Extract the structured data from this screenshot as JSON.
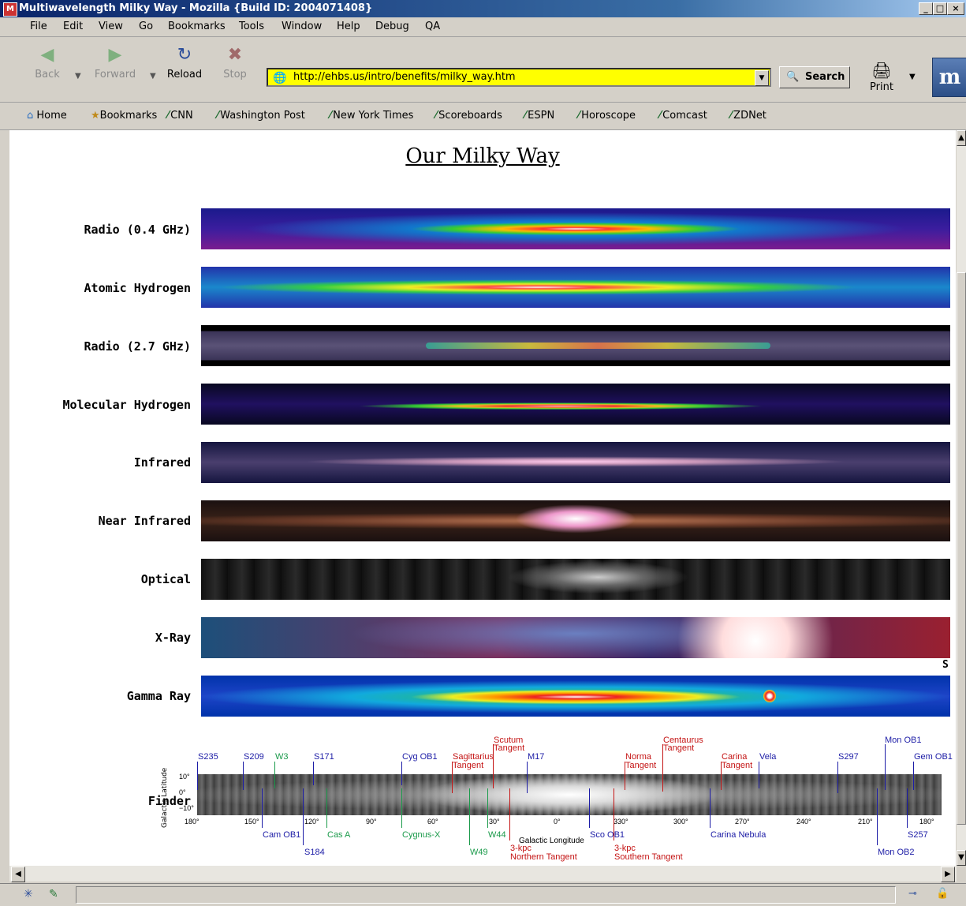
{
  "window": {
    "title": "Multiwavelength Milky Way - Mozilla {Build ID: 2004071408}",
    "controls": [
      "_",
      "□",
      "×"
    ]
  },
  "menu": [
    "File",
    "Edit",
    "View",
    "Go",
    "Bookmarks",
    "Tools",
    "Window",
    "Help",
    "Debug",
    "QA"
  ],
  "nav": {
    "back": "Back",
    "forward": "Forward",
    "reload": "Reload",
    "stop": "Stop",
    "url": "http://ehbs.us/intro/benefits/milky_way.htm",
    "search": "Search",
    "print": "Print",
    "throbber_letter": "m"
  },
  "bookmarks": [
    "Home",
    "Bookmarks",
    "CNN",
    "Washington Post",
    "New York Times",
    "Scoreboards",
    "ESPN",
    "Horoscope",
    "Comcast",
    "ZDNet"
  ],
  "page": {
    "title": "Our Milky Way",
    "bands": [
      "Radio (0.4 GHz)",
      "Atomic Hydrogen",
      "Radio (2.7 GHz)",
      "Molecular Hydrogen",
      "Infrared",
      "Near Infrared",
      "Optical",
      "X-Ray",
      "Gamma Ray"
    ],
    "stray_letter": "S",
    "finder": {
      "label": "Finder",
      "y_axis_label": "Galactic Latitude",
      "y_ticks": [
        "10°",
        "0°",
        "−10°"
      ],
      "x_ticks": [
        "180°",
        "150°",
        "120°",
        "90°",
        "60°",
        "30°",
        "0°",
        "330°",
        "300°",
        "270°",
        "240°",
        "210°",
        "180°"
      ],
      "x_axis_label": "Galactic Longitude",
      "labels_top": [
        "S235",
        "S209",
        "W3",
        "S171",
        "Cyg OB1",
        "Sagittarius",
        "Tangent",
        "Scutum",
        "Tangent",
        "M17",
        "Norma",
        "Tangent",
        "Centaurus",
        "Tangent",
        "Carina",
        "Tangent",
        "Vela",
        "S297",
        "Mon OB1",
        "Gem OB1"
      ],
      "labels_bottom": [
        "Cam OB1",
        "S184",
        "Cas A",
        "Cygnus-X",
        "W49",
        "W44",
        "3-kpc",
        "Northern Tangent",
        "Sco OB1",
        "3-kpc",
        "Southern Tangent",
        "Carina Nebula",
        "S257",
        "Mon OB2"
      ]
    }
  },
  "colors": {
    "url_bg": "#ffff00",
    "finder_blue": "#1c1ca6",
    "finder_green": "#1a9a4a",
    "finder_red": "#c41414"
  }
}
